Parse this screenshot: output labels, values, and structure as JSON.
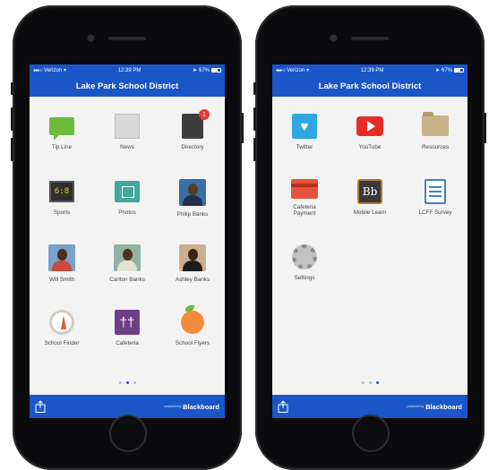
{
  "status": {
    "carrier": "Verizon",
    "signal": "●●●○○",
    "time": "12:39 PM",
    "battery": "67%"
  },
  "title": "Lake Park School District",
  "page1": {
    "apps": [
      {
        "label": "Tip Line",
        "icon": "chat-bubble-icon"
      },
      {
        "label": "News",
        "icon": "newspaper-icon"
      },
      {
        "label": "Directory",
        "icon": "address-book-icon",
        "badge": "1"
      },
      {
        "label": "Sports",
        "icon": "scoreboard-icon",
        "glyph": "6:8"
      },
      {
        "label": "Photos",
        "icon": "photo-icon"
      },
      {
        "label": "Philip Banks",
        "icon": "contact-photo-icon"
      },
      {
        "label": "Will Smith",
        "icon": "contact-photo-icon"
      },
      {
        "label": "Carlton Banks",
        "icon": "contact-photo-icon"
      },
      {
        "label": "Ashley Banks",
        "icon": "contact-photo-icon"
      },
      {
        "label": "School Finder",
        "icon": "compass-icon"
      },
      {
        "label": "Cafeteria",
        "icon": "fork-knife-icon",
        "glyph": "††"
      },
      {
        "label": "School Flyers",
        "icon": "peach-icon"
      }
    ],
    "page_indicator": {
      "current": 2,
      "total": 3
    }
  },
  "page2": {
    "apps": [
      {
        "label": "Twitter",
        "icon": "twitter-bird-icon",
        "glyph": "♥"
      },
      {
        "label": "YouTube",
        "icon": "youtube-play-icon"
      },
      {
        "label": "Resources",
        "icon": "folder-icon"
      },
      {
        "label": "Cafeteria\nPayment",
        "icon": "credit-card-icon"
      },
      {
        "label": "Mobile Learn",
        "icon": "mobile-learn-icon",
        "glyph": "Bb"
      },
      {
        "label": "LCFF Survey",
        "icon": "clipboard-icon"
      },
      {
        "label": "Settings",
        "icon": "gear-icon"
      }
    ],
    "page_indicator": {
      "current": 3,
      "total": 3
    }
  },
  "footer": {
    "powered_by": "powered by",
    "brand": "Blackboard"
  },
  "colors": {
    "brand_blue": "#1a56c8",
    "screen_bg": "#f3f3f3"
  }
}
